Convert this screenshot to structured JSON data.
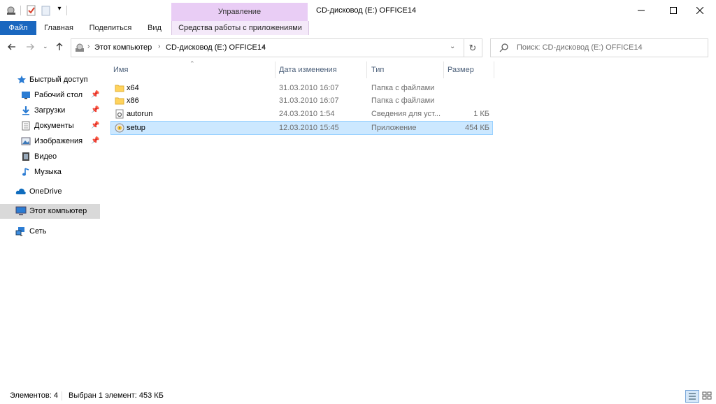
{
  "titlebar": {
    "context_group": "Управление",
    "window_title": "CD-дисковод (E:) OFFICE14"
  },
  "ribbon": {
    "tabs": [
      "Файл",
      "Главная",
      "Поделиться",
      "Вид"
    ],
    "context_tab": "Средства работы с приложениями"
  },
  "address": {
    "segments": [
      "Этот компьютер",
      "CD-дисковод (E:) OFFICE14"
    ]
  },
  "search": {
    "placeholder": "Поиск: CD-дисковод (E:) OFFICE14"
  },
  "sidebar": {
    "quick_access": "Быстрый доступ",
    "items": [
      {
        "label": "Рабочий стол",
        "icon": "desktop-icon",
        "pinned": true
      },
      {
        "label": "Загрузки",
        "icon": "downloads-icon",
        "pinned": true
      },
      {
        "label": "Документы",
        "icon": "documents-icon",
        "pinned": true
      },
      {
        "label": "Изображения",
        "icon": "pictures-icon",
        "pinned": true
      },
      {
        "label": "Видео",
        "icon": "videos-icon",
        "pinned": false
      },
      {
        "label": "Музыка",
        "icon": "music-icon",
        "pinned": false
      }
    ],
    "onedrive": "OneDrive",
    "this_pc": "Этот компьютер",
    "network": "Сеть"
  },
  "columns": {
    "name": "Имя",
    "date": "Дата изменения",
    "type": "Тип",
    "size": "Размер"
  },
  "files": [
    {
      "name": "x64",
      "date": "31.03.2010 16:07",
      "type": "Папка с файлами",
      "size": "",
      "icon": "folder-icon",
      "selected": false
    },
    {
      "name": "x86",
      "date": "31.03.2010 16:07",
      "type": "Папка с файлами",
      "size": "",
      "icon": "folder-icon",
      "selected": false
    },
    {
      "name": "autorun",
      "date": "24.03.2010 1:54",
      "type": "Сведения для уст...",
      "size": "1 КБ",
      "icon": "settings-file-icon",
      "selected": false
    },
    {
      "name": "setup",
      "date": "12.03.2010 15:45",
      "type": "Приложение",
      "size": "454 КБ",
      "icon": "installer-icon",
      "selected": true
    }
  ],
  "status": {
    "count": "Элементов: 4",
    "selection": "Выбран 1 элемент: 453 КБ"
  },
  "colors": {
    "file_tab": "#1a67bf",
    "context_header": "#e9cdf5",
    "selection": "#cce8ff",
    "selection_border": "#99d1ff"
  }
}
